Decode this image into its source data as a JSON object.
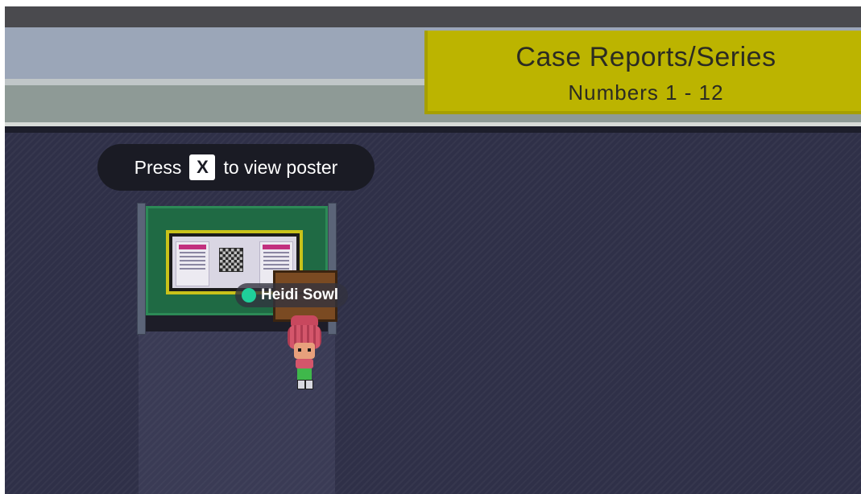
{
  "sign": {
    "title": "Case Reports/Series",
    "subtitle": "Numbers 1 - 12"
  },
  "prompt": {
    "before": "Press",
    "key": "X",
    "after": "to view poster"
  },
  "player": {
    "name": "Heidi Sowl",
    "status_color": "#1fcf9a"
  },
  "colors": {
    "floor": "#2f3048",
    "sign": "#bcb400",
    "board": "#1f6a44",
    "poster_frame": "#c9c21a"
  }
}
